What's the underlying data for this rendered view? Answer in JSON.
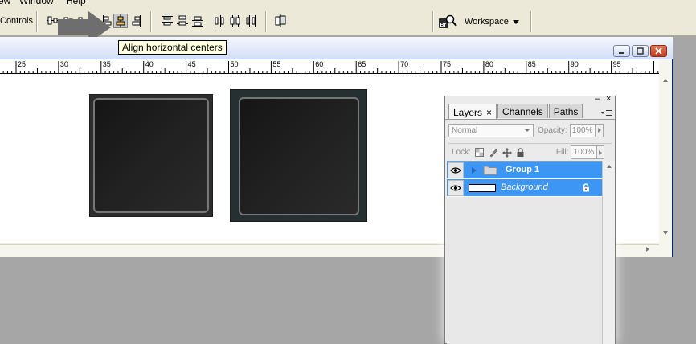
{
  "menubar": {
    "items": [
      "ew",
      "Window",
      "Help"
    ]
  },
  "options_bar": {
    "controls_label": "Controls",
    "workspace_label": "Workspace",
    "bridge_label": "Br"
  },
  "tooltip": {
    "text": "Align horizontal centers"
  },
  "ruler": {
    "labels": [
      "25",
      "30",
      "35",
      "40",
      "45",
      "50",
      "55",
      "60",
      "65",
      "70",
      "75",
      "80",
      "85",
      "90",
      "95"
    ]
  },
  "layers_panel": {
    "tabs": [
      {
        "label": "Layers",
        "close": "×"
      },
      {
        "label": "Channels"
      },
      {
        "label": "Paths"
      }
    ],
    "panel_min": "–",
    "panel_close": "×",
    "blend_mode": "Normal",
    "opacity_label": "Opacity:",
    "opacity_value": "100%",
    "lock_label": "Lock:",
    "fill_label": "Fill:",
    "fill_value": "100%",
    "layers": [
      {
        "name": "Group 1",
        "type": "group"
      },
      {
        "name": "Background",
        "type": "background",
        "locked": true
      }
    ]
  },
  "colors": {
    "selection": "#3d95f4",
    "workspace_bg": "#a6a6a6",
    "chrome": "#ece9d8"
  }
}
